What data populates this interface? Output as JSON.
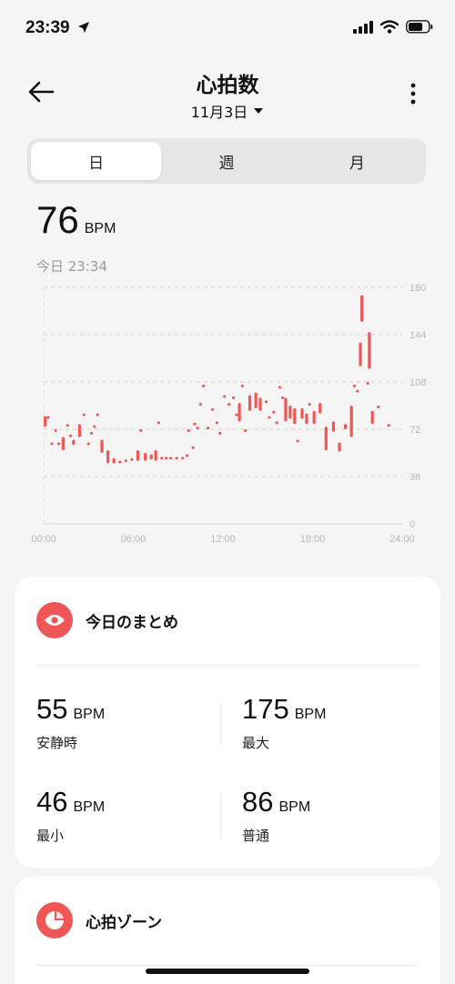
{
  "status": {
    "time": "23:39"
  },
  "header": {
    "title": "心拍数",
    "date": "11月3日"
  },
  "tabs": [
    {
      "label": "日",
      "active": true
    },
    {
      "label": "週",
      "active": false
    },
    {
      "label": "月",
      "active": false
    }
  ],
  "current": {
    "value": "76",
    "unit": "BPM",
    "time_label": "今日 23:34"
  },
  "chart_data": {
    "type": "bar",
    "x_ticks": [
      "00:00",
      "06:00",
      "12:00",
      "18:00",
      "24:00"
    ],
    "y_ticks": [
      "0",
      "36",
      "72",
      "108",
      "144",
      "180"
    ],
    "ylim": [
      0,
      180
    ],
    "xlim": [
      0,
      24
    ],
    "grid": true,
    "color": "#f05656",
    "ranges": [
      {
        "t": 0.1,
        "lo": 74,
        "hi": 82
      },
      {
        "t": 0.3,
        "lo": 80,
        "hi": 82
      },
      {
        "t": 0.55,
        "lo": 60,
        "hi": 62
      },
      {
        "t": 0.8,
        "lo": 70,
        "hi": 72
      },
      {
        "t": 1.0,
        "lo": 60,
        "hi": 62
      },
      {
        "t": 1.3,
        "lo": 56,
        "hi": 66
      },
      {
        "t": 1.6,
        "lo": 74,
        "hi": 76
      },
      {
        "t": 1.8,
        "lo": 66,
        "hi": 68
      },
      {
        "t": 2.0,
        "lo": 60,
        "hi": 64
      },
      {
        "t": 2.4,
        "lo": 66,
        "hi": 76
      },
      {
        "t": 2.7,
        "lo": 82,
        "hi": 84
      },
      {
        "t": 3.0,
        "lo": 60,
        "hi": 62
      },
      {
        "t": 3.2,
        "lo": 68,
        "hi": 70
      },
      {
        "t": 3.4,
        "lo": 73,
        "hi": 75
      },
      {
        "t": 3.6,
        "lo": 82,
        "hi": 84
      },
      {
        "t": 3.9,
        "lo": 54,
        "hi": 64
      },
      {
        "t": 4.3,
        "lo": 46,
        "hi": 56
      },
      {
        "t": 4.7,
        "lo": 46,
        "hi": 50
      },
      {
        "t": 5.1,
        "lo": 46,
        "hi": 48
      },
      {
        "t": 5.5,
        "lo": 47,
        "hi": 49
      },
      {
        "t": 5.9,
        "lo": 48,
        "hi": 50
      },
      {
        "t": 6.3,
        "lo": 48,
        "hi": 56
      },
      {
        "t": 6.5,
        "lo": 70,
        "hi": 72
      },
      {
        "t": 6.8,
        "lo": 48,
        "hi": 54
      },
      {
        "t": 7.2,
        "lo": 49,
        "hi": 53
      },
      {
        "t": 7.5,
        "lo": 48,
        "hi": 56
      },
      {
        "t": 7.7,
        "lo": 76,
        "hi": 78
      },
      {
        "t": 7.9,
        "lo": 49,
        "hi": 51
      },
      {
        "t": 8.2,
        "lo": 49,
        "hi": 51
      },
      {
        "t": 8.5,
        "lo": 49,
        "hi": 51
      },
      {
        "t": 8.9,
        "lo": 49,
        "hi": 51
      },
      {
        "t": 9.3,
        "lo": 49,
        "hi": 51
      },
      {
        "t": 9.6,
        "lo": 51,
        "hi": 53
      },
      {
        "t": 9.7,
        "lo": 70,
        "hi": 72
      },
      {
        "t": 10.0,
        "lo": 57,
        "hi": 59
      },
      {
        "t": 10.1,
        "lo": 75,
        "hi": 77
      },
      {
        "t": 10.3,
        "lo": 72,
        "hi": 74
      },
      {
        "t": 10.5,
        "lo": 90,
        "hi": 92
      },
      {
        "t": 10.7,
        "lo": 104,
        "hi": 106
      },
      {
        "t": 11.0,
        "lo": 72,
        "hi": 74
      },
      {
        "t": 11.3,
        "lo": 86,
        "hi": 88
      },
      {
        "t": 11.6,
        "lo": 76,
        "hi": 78
      },
      {
        "t": 11.8,
        "lo": 68,
        "hi": 70
      },
      {
        "t": 12.1,
        "lo": 96,
        "hi": 98
      },
      {
        "t": 12.4,
        "lo": 90,
        "hi": 92
      },
      {
        "t": 12.7,
        "lo": 95,
        "hi": 97
      },
      {
        "t": 12.9,
        "lo": 82,
        "hi": 84
      },
      {
        "t": 13.1,
        "lo": 78,
        "hi": 92
      },
      {
        "t": 13.3,
        "lo": 104,
        "hi": 106
      },
      {
        "t": 13.5,
        "lo": 70,
        "hi": 72
      },
      {
        "t": 13.8,
        "lo": 86,
        "hi": 98
      },
      {
        "t": 14.2,
        "lo": 88,
        "hi": 100
      },
      {
        "t": 14.5,
        "lo": 86,
        "hi": 96
      },
      {
        "t": 14.9,
        "lo": 92,
        "hi": 94
      },
      {
        "t": 15.1,
        "lo": 80,
        "hi": 82
      },
      {
        "t": 15.4,
        "lo": 84,
        "hi": 86
      },
      {
        "t": 15.6,
        "lo": 76,
        "hi": 78
      },
      {
        "t": 15.8,
        "lo": 103,
        "hi": 105
      },
      {
        "t": 16.0,
        "lo": 95,
        "hi": 97
      },
      {
        "t": 16.2,
        "lo": 78,
        "hi": 96
      },
      {
        "t": 16.5,
        "lo": 80,
        "hi": 90
      },
      {
        "t": 16.8,
        "lo": 76,
        "hi": 88
      },
      {
        "t": 17.0,
        "lo": 62,
        "hi": 64
      },
      {
        "t": 17.3,
        "lo": 80,
        "hi": 88
      },
      {
        "t": 17.6,
        "lo": 76,
        "hi": 84
      },
      {
        "t": 17.8,
        "lo": 90,
        "hi": 92
      },
      {
        "t": 18.1,
        "lo": 76,
        "hi": 86
      },
      {
        "t": 18.5,
        "lo": 84,
        "hi": 92
      },
      {
        "t": 18.9,
        "lo": 56,
        "hi": 74
      },
      {
        "t": 19.4,
        "lo": 70,
        "hi": 78
      },
      {
        "t": 19.8,
        "lo": 55,
        "hi": 62
      },
      {
        "t": 20.2,
        "lo": 72,
        "hi": 76
      },
      {
        "t": 20.6,
        "lo": 66,
        "hi": 90
      },
      {
        "t": 20.8,
        "lo": 104,
        "hi": 106
      },
      {
        "t": 21.0,
        "lo": 100,
        "hi": 102
      },
      {
        "t": 21.2,
        "lo": 120,
        "hi": 138
      },
      {
        "t": 21.3,
        "lo": 154,
        "hi": 174
      },
      {
        "t": 21.7,
        "lo": 106,
        "hi": 108
      },
      {
        "t": 21.8,
        "lo": 118,
        "hi": 146
      },
      {
        "t": 22.0,
        "lo": 76,
        "hi": 86
      },
      {
        "t": 22.4,
        "lo": 88,
        "hi": 90
      },
      {
        "t": 23.1,
        "lo": 74,
        "hi": 76
      }
    ]
  },
  "summary": {
    "title": "今日のまとめ",
    "items": [
      {
        "value": "55",
        "unit": "BPM",
        "label": "安静時"
      },
      {
        "value": "175",
        "unit": "BPM",
        "label": "最大"
      },
      {
        "value": "46",
        "unit": "BPM",
        "label": "最小"
      },
      {
        "value": "86",
        "unit": "BPM",
        "label": "普通"
      }
    ]
  },
  "zone": {
    "title": "心拍ゾーン"
  },
  "colors": {
    "accent": "#f05656",
    "background": "#f5f5f5",
    "card": "#ffffff"
  },
  "icons": {
    "back": "arrow-left-icon",
    "more": "vertical-dots-icon",
    "dropdown": "caret-down-icon",
    "summary": "eye-icon",
    "zone": "pie-chart-icon"
  }
}
